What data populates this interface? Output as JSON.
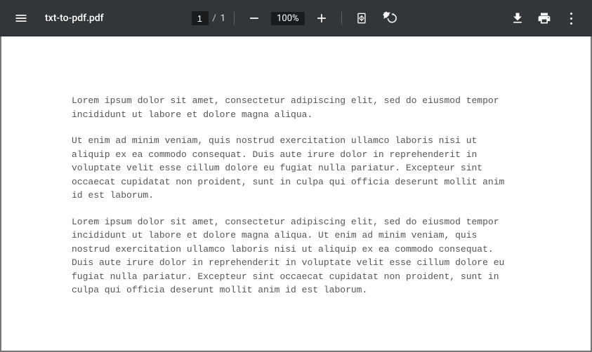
{
  "toolbar": {
    "filename": "txt-to-pdf.pdf",
    "page_current": "1",
    "page_sep": "/",
    "page_total": "1",
    "zoom_label": "100%"
  },
  "document": {
    "paragraphs": [
      "Lorem ipsum dolor sit amet, consectetur adipiscing elit, sed do eiusmod tempor incididunt ut labore et dolore magna aliqua.",
      "Ut enim ad minim veniam, quis nostrud exercitation ullamco laboris nisi ut aliquip ex ea commodo consequat. Duis aute irure dolor in reprehenderit in voluptate velit esse cillum dolore eu fugiat nulla pariatur. Excepteur sint occaecat cupidatat non proident, sunt in culpa qui officia deserunt mollit anim id est laborum.",
      "Lorem ipsum dolor sit amet, consectetur adipiscing elit, sed do eiusmod tempor incididunt ut labore et dolore magna aliqua. Ut enim ad minim veniam, quis nostrud exercitation ullamco laboris nisi ut aliquip ex ea commodo consequat. Duis aute irure dolor in reprehenderit in voluptate velit esse cillum dolore eu fugiat nulla pariatur. Excepteur sint occaecat cupidatat non proident, sunt in culpa qui officia deserunt mollit anim id est laborum."
    ]
  }
}
